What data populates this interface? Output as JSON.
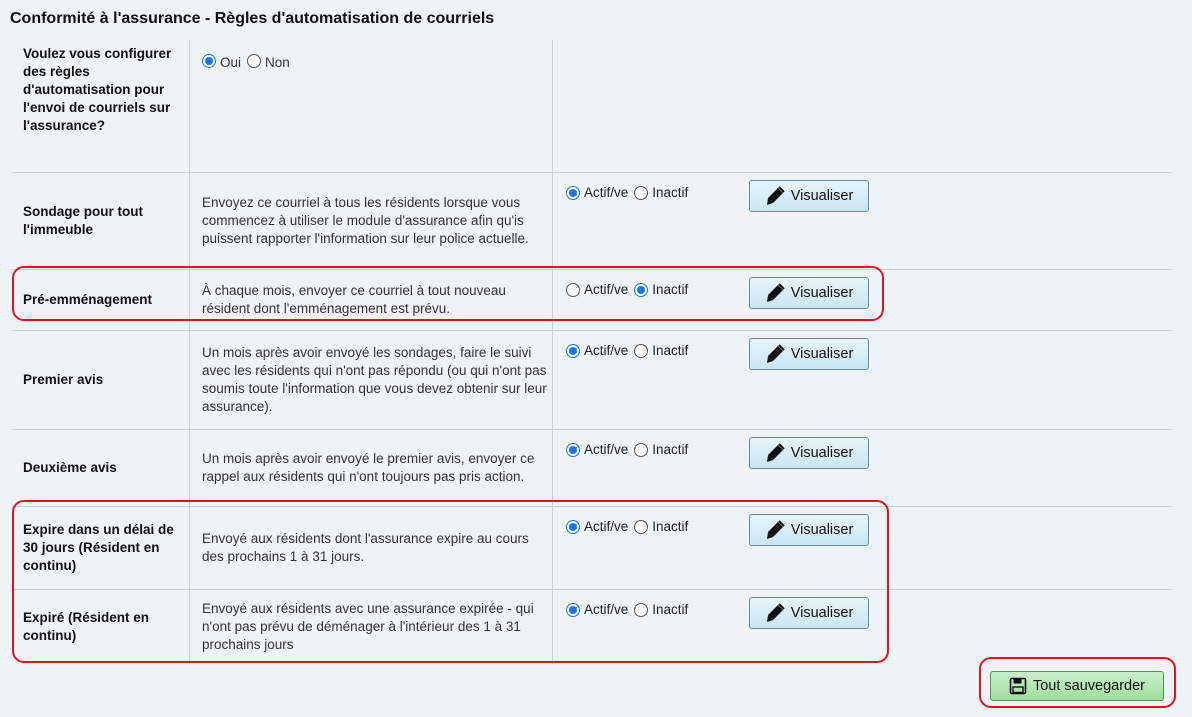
{
  "page": {
    "title": "Conformité à l'assurance - Règles d'automatisation de courriels"
  },
  "setup": {
    "question": "Voulez vous configurer des règles d'automatisation pour l'envoi de courriels sur l'assurance?",
    "option_yes": "Oui",
    "option_no": "Non",
    "selected": "Oui"
  },
  "labels": {
    "active": "Actif/ve",
    "inactive": "Inactif",
    "view": "Visualiser",
    "save_all": "Tout sauvegarder"
  },
  "rules": [
    {
      "name": "Sondage pour tout l'immeuble",
      "description": "Envoyez ce courriel à tous les résidents lorsque vous commencez à utiliser le module d'assurance afin qu'is puissent rapporter l'information sur leur police actuelle.",
      "status": "Actif/ve"
    },
    {
      "name": "Pré-emménagement",
      "description": "À chaque mois, envoyer ce courriel à tout nouveau résident dont l'emménagement est prévu.",
      "status": "Inactif"
    },
    {
      "name": "Premier avis",
      "description": "Un mois après avoir envoyé les sondages, faire le suivi avec les résidents qui n'ont pas répondu (ou qui n'ont pas soumis toute l'information que vous devez obtenir sur leur assurance).",
      "status": "Actif/ve"
    },
    {
      "name": "Deuxième avis",
      "description": "Un mois après avoir envoyé le premier avis, envoyer ce rappel aux résidents qui n'ont toujours pas pris action.",
      "status": "Actif/ve"
    },
    {
      "name": "Expire dans un délai de 30 jours (Résident en continu)",
      "description": "Envoyé aux résidents dont l'assurance expire au cours des prochains 1 à 31 jours.",
      "status": "Actif/ve"
    },
    {
      "name": "Expiré (Résident en continu)",
      "description": "Envoyé aux résidents avec une assurance expirée - qui n'ont pas prévu de déménager à l'intérieur des 1 à 31 prochains jours",
      "status": "Actif/ve"
    }
  ],
  "colors": {
    "background": "#eef3f8",
    "radio_checked": "#1a73e8",
    "highlight": "#e0141e",
    "view_button": "#c9e6f3",
    "save_button": "#9fdc9f"
  },
  "icons": {
    "view": "pen-icon",
    "save": "floppy-disk-icon"
  }
}
